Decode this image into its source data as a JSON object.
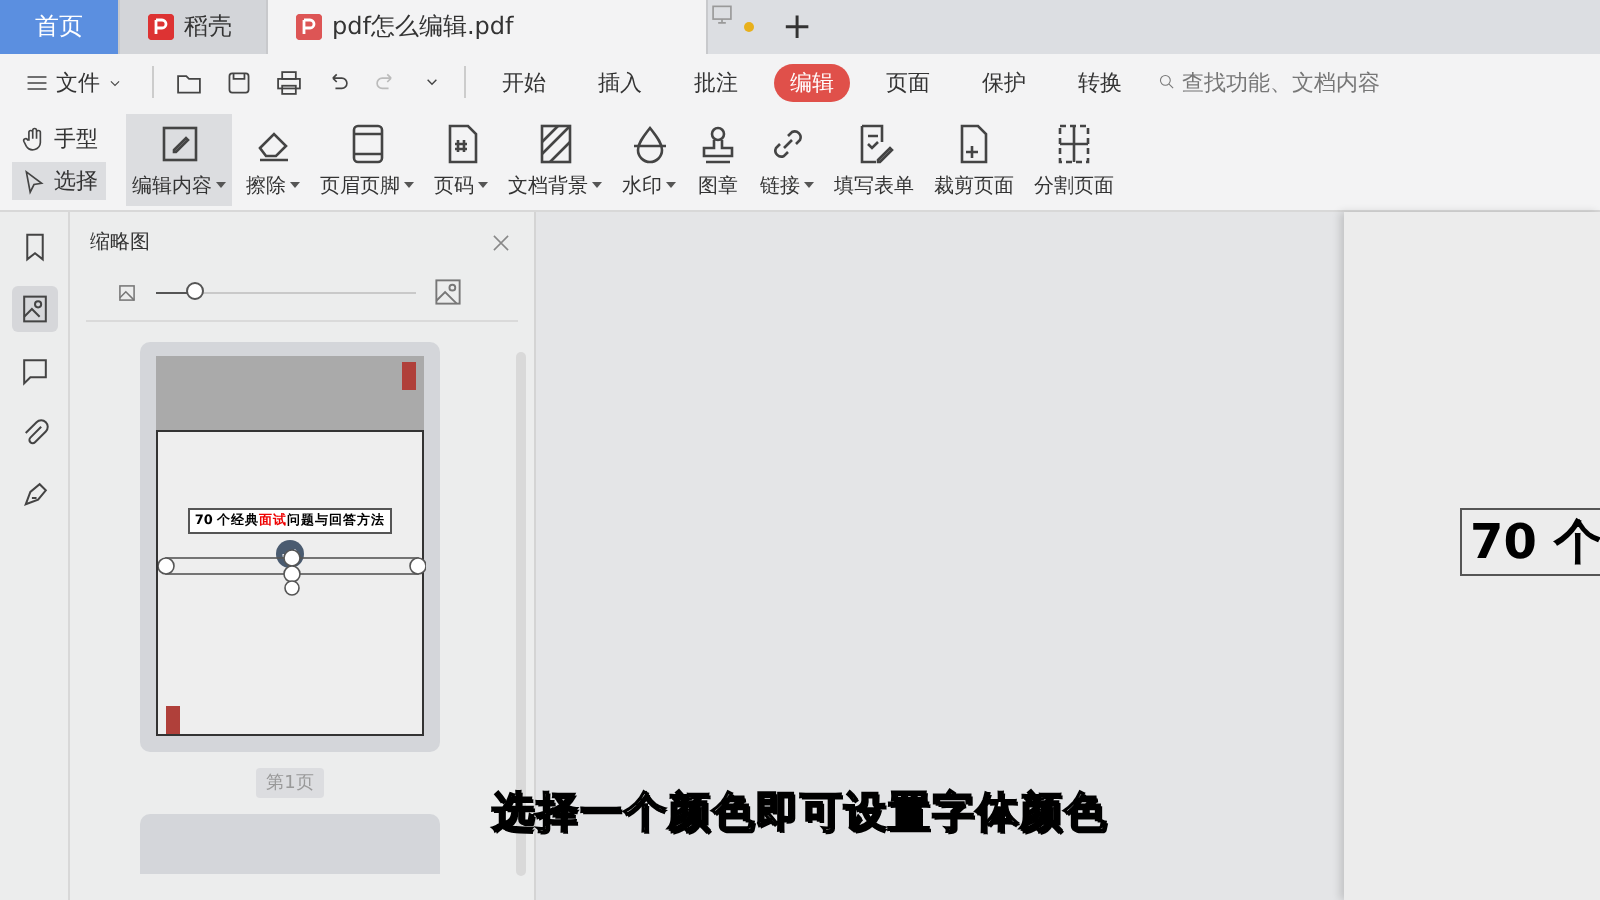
{
  "tabs": [
    {
      "label": "首页",
      "kind": "home",
      "selected": false
    },
    {
      "label": "稻壳",
      "kind": "app",
      "selected": false
    },
    {
      "label": "pdf怎么编辑.pdf",
      "kind": "doc",
      "selected": true
    }
  ],
  "new_tab": "+",
  "menu": {
    "file": "文件",
    "tabs": [
      {
        "label": "开始",
        "selected": false
      },
      {
        "label": "插入",
        "selected": false
      },
      {
        "label": "批注",
        "selected": false
      },
      {
        "label": "编辑",
        "selected": true
      },
      {
        "label": "页面",
        "selected": false
      },
      {
        "label": "保护",
        "selected": false
      },
      {
        "label": "转换",
        "selected": false
      }
    ],
    "search": {
      "placeholder": "查找功能、文档内容"
    }
  },
  "modes": [
    {
      "label": "手型",
      "selected": false
    },
    {
      "label": "选择",
      "selected": true
    }
  ],
  "ribbon": [
    {
      "label": "编辑内容",
      "dropdown": true,
      "selected": true
    },
    {
      "label": "擦除",
      "dropdown": true,
      "selected": false
    },
    {
      "label": "页眉页脚",
      "dropdown": true,
      "selected": false
    },
    {
      "label": "页码",
      "dropdown": true,
      "selected": false
    },
    {
      "label": "文档背景",
      "dropdown": true,
      "selected": false
    },
    {
      "label": "水印",
      "dropdown": true,
      "selected": false
    },
    {
      "label": "图章",
      "dropdown": false,
      "selected": false
    },
    {
      "label": "链接",
      "dropdown": true,
      "selected": false
    },
    {
      "label": "填写表单",
      "dropdown": false,
      "selected": false
    },
    {
      "label": "裁剪页面",
      "dropdown": false,
      "selected": false
    },
    {
      "label": "分割页面",
      "dropdown": false,
      "selected": false
    }
  ],
  "side_icons": [
    {
      "selected": false
    },
    {
      "selected": true
    },
    {
      "selected": false
    },
    {
      "selected": false
    },
    {
      "selected": false
    }
  ],
  "thumbnail_panel": {
    "title": "缩略图",
    "zoom": {
      "level": 0.15
    },
    "page_label": "第1页",
    "thumbnail_title": [
      {
        "text": "70 个经典",
        "highlight": false
      },
      {
        "text": "面试",
        "highlight": true
      },
      {
        "text": "问题与回答方法",
        "highlight": false
      }
    ]
  },
  "document": {
    "heading": "70 个"
  },
  "caption": "选择一个颜色即可设置字体颜色"
}
